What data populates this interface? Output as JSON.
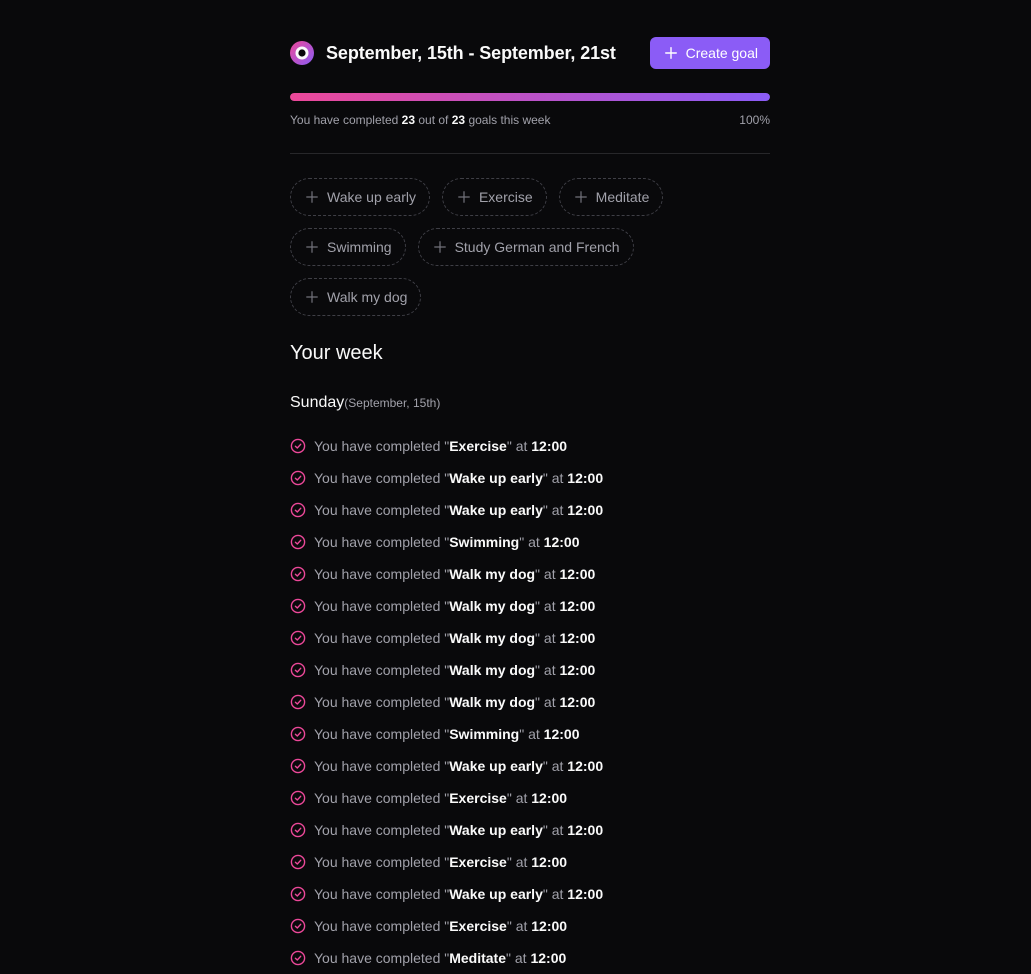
{
  "header": {
    "week_range": "September, 15th - September, 21st",
    "create_goal_label": "Create goal"
  },
  "progress": {
    "prefix": "You have completed",
    "completed": "23",
    "middle": "out of",
    "total": "23",
    "suffix": "goals this week",
    "percent_label": "100%",
    "fraction": 1.0
  },
  "goals": [
    "Wake up early",
    "Exercise",
    "Meditate",
    "Swimming",
    "Study German and French",
    "Walk my dog"
  ],
  "summary": {
    "title": "Your week",
    "days": [
      {
        "name": "Sunday",
        "date": "(September, 15th)",
        "events": [
          {
            "prefix": "You have completed \"",
            "goal": "Exercise",
            "middle": "\" at",
            "time": "12:00"
          },
          {
            "prefix": "You have completed \"",
            "goal": "Wake up early",
            "middle": "\" at",
            "time": "12:00"
          },
          {
            "prefix": "You have completed \"",
            "goal": "Wake up early",
            "middle": "\" at",
            "time": "12:00"
          },
          {
            "prefix": "You have completed \"",
            "goal": "Swimming",
            "middle": "\" at",
            "time": "12:00"
          },
          {
            "prefix": "You have completed \"",
            "goal": "Walk my dog",
            "middle": "\" at",
            "time": "12:00"
          },
          {
            "prefix": "You have completed \"",
            "goal": "Walk my dog",
            "middle": "\" at",
            "time": "12:00"
          },
          {
            "prefix": "You have completed \"",
            "goal": "Walk my dog",
            "middle": "\" at",
            "time": "12:00"
          },
          {
            "prefix": "You have completed \"",
            "goal": "Walk my dog",
            "middle": "\" at",
            "time": "12:00"
          },
          {
            "prefix": "You have completed \"",
            "goal": "Walk my dog",
            "middle": "\" at",
            "time": "12:00"
          },
          {
            "prefix": "You have completed \"",
            "goal": "Swimming",
            "middle": "\" at",
            "time": "12:00"
          },
          {
            "prefix": "You have completed \"",
            "goal": "Wake up early",
            "middle": "\" at",
            "time": "12:00"
          },
          {
            "prefix": "You have completed \"",
            "goal": "Exercise",
            "middle": "\" at",
            "time": "12:00"
          },
          {
            "prefix": "You have completed \"",
            "goal": "Wake up early",
            "middle": "\" at",
            "time": "12:00"
          },
          {
            "prefix": "You have completed \"",
            "goal": "Exercise",
            "middle": "\" at",
            "time": "12:00"
          },
          {
            "prefix": "You have completed \"",
            "goal": "Wake up early",
            "middle": "\" at",
            "time": "12:00"
          },
          {
            "prefix": "You have completed \"",
            "goal": "Exercise",
            "middle": "\" at",
            "time": "12:00"
          },
          {
            "prefix": "You have completed \"",
            "goal": "Meditate",
            "middle": "\" at",
            "time": "12:00"
          }
        ]
      }
    ]
  },
  "icons": {
    "logo": "logo-icon",
    "create": "plus-icon",
    "goal_add": "plus-icon",
    "completed": "check-circle-icon"
  },
  "colors": {
    "background": "#09090b",
    "accent": "#8b5cf6",
    "gradient_start": "#ec4899",
    "gradient_end": "#8b5cf6",
    "completed_icon": "#ec4899"
  }
}
